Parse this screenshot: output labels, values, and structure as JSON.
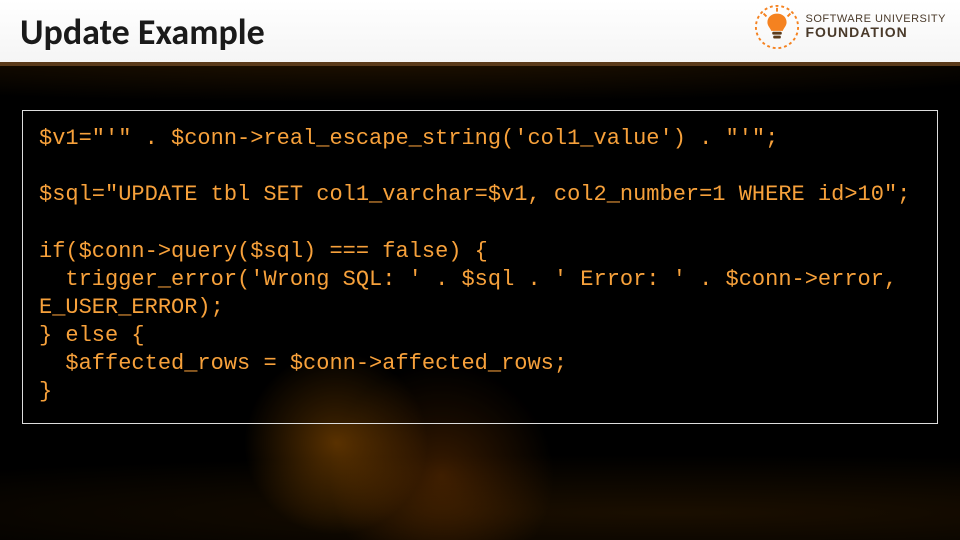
{
  "slide": {
    "title": "Update Example"
  },
  "logo": {
    "line1": "SOFTWARE UNIVERSITY",
    "line2": "FOUNDATION"
  },
  "code": "$v1=\"'\" . $conn->real_escape_string('col1_value') . \"'\";\n\n$sql=\"UPDATE tbl SET col1_varchar=$v1, col2_number=1 WHERE id>10\";\n\nif($conn->query($sql) === false) {\n  trigger_error('Wrong SQL: ' . $sql . ' Error: ' . $conn->error, E_USER_ERROR);\n} else {\n  $affected_rows = $conn->affected_rows;\n}"
}
